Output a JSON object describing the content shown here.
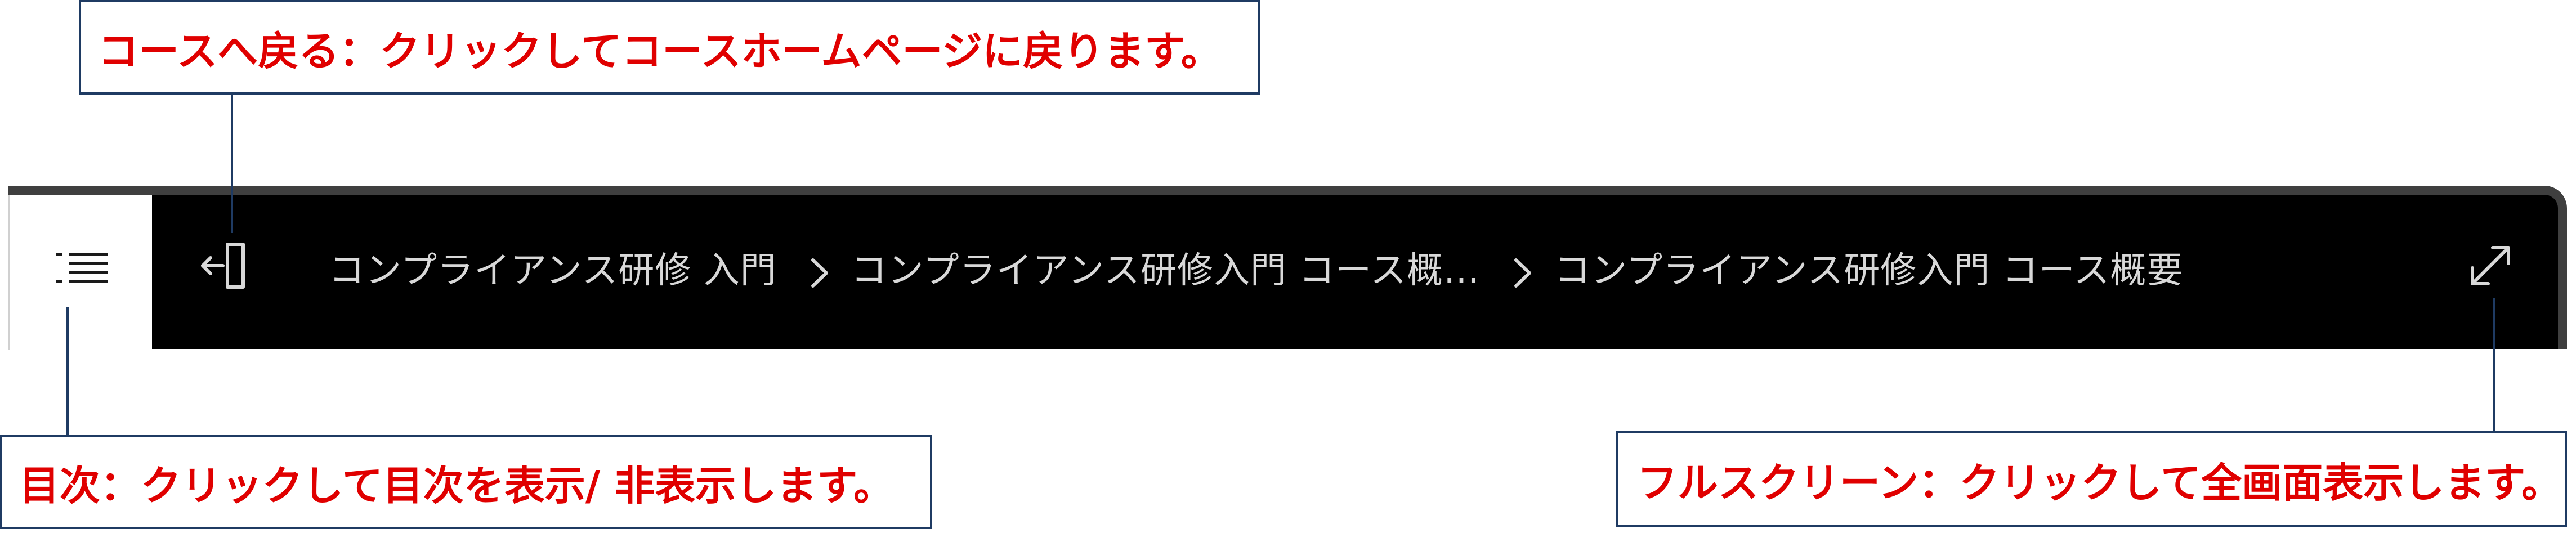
{
  "toolbar": {
    "toc_icon": "list-icon",
    "back_icon": "exit-to-course-icon",
    "fullscreen_icon": "expand-diagonal-icon",
    "breadcrumb": [
      "コンプライアンス研修 入門",
      "コンプライアンス研修入門 コース概…",
      "コンプライアンス研修入門 コース概要"
    ],
    "separator_icon": "chevron-right-icon"
  },
  "callouts": {
    "back": "コースへ戻る：クリックしてコースホームページに戻ります。",
    "toc": "目次：クリックして目次を表示/ 非表示します。",
    "fullscreen": "フルスクリーン：クリックして全画面表示します。"
  },
  "colors": {
    "toolbar_bg": "#000000",
    "toolbar_text": "#d8d8d8",
    "callout_text": "#e00000",
    "callout_border": "#1f3b63"
  }
}
